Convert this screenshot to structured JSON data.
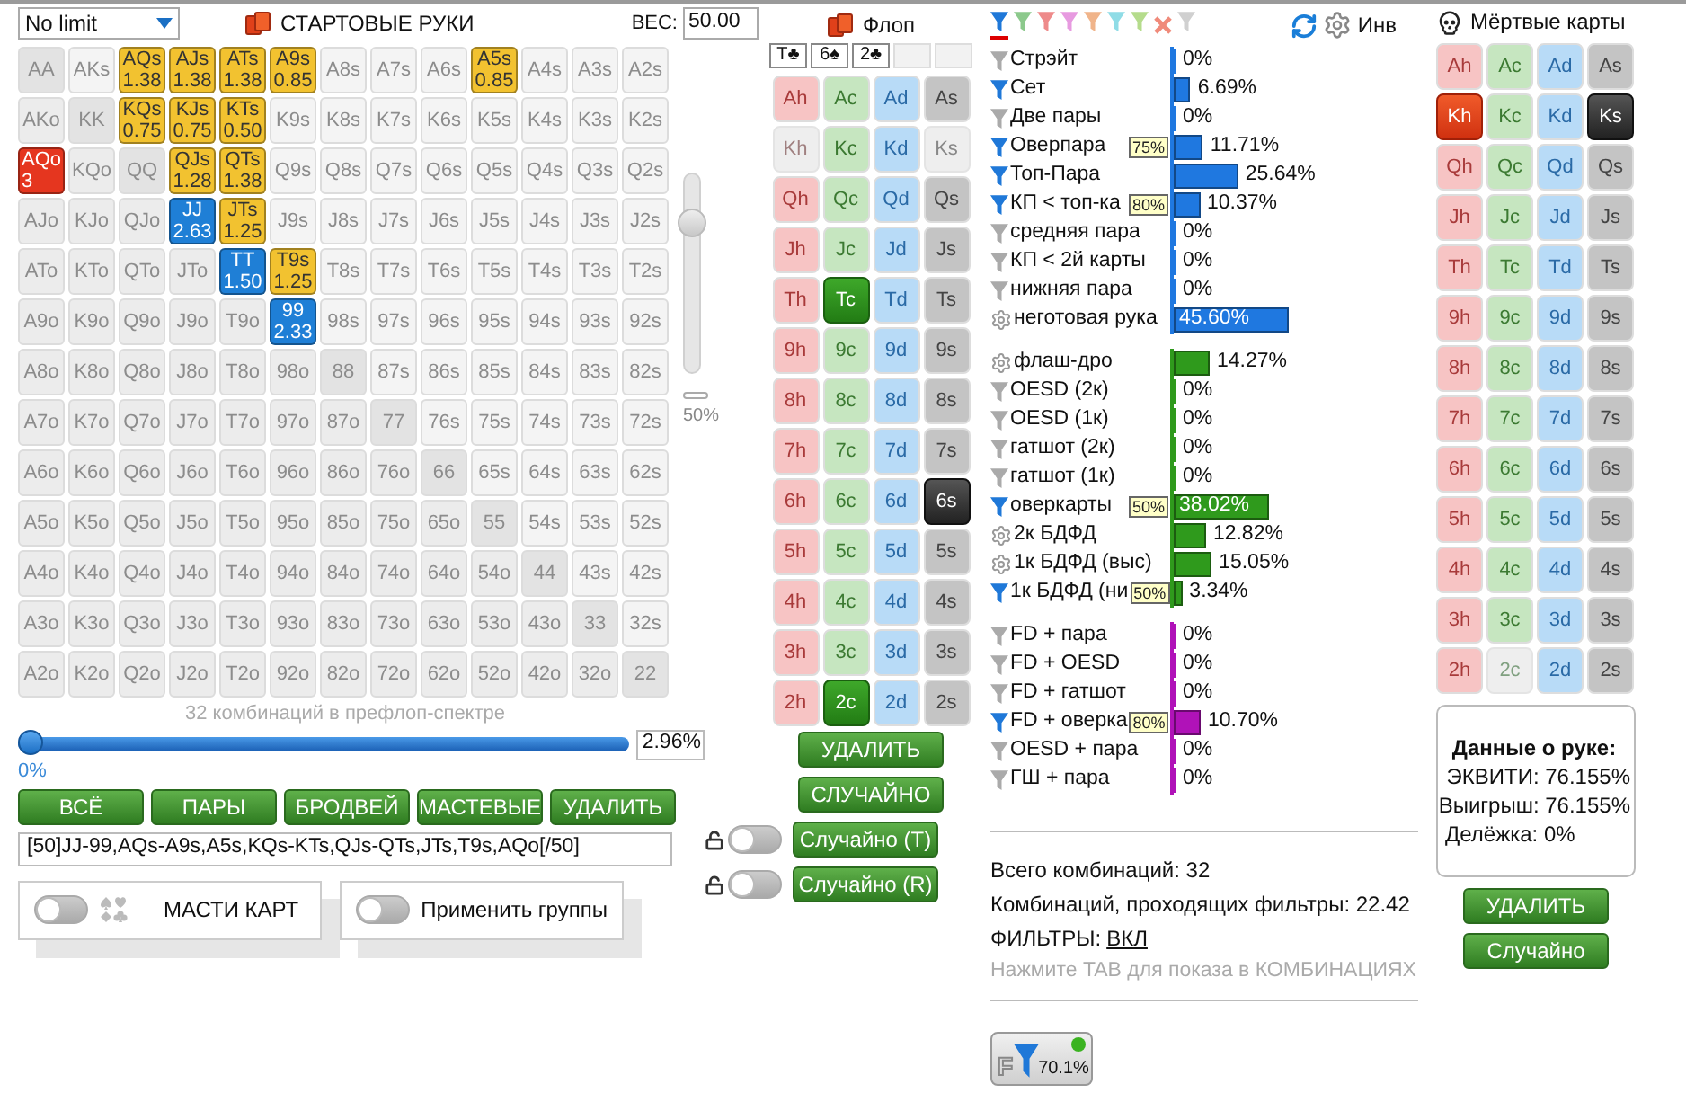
{
  "range_panel": {
    "game_select": {
      "value": "No limit"
    },
    "title": "СТАРТОВЫЕ РУКИ",
    "weight_label": "ВЕС:",
    "weight_field": {
      "value": "50.00"
    },
    "hand_grid": [
      [
        {
          "hand": "AA",
          "kind": "pair",
          "selected": false
        },
        {
          "hand": "AKs",
          "kind": "suited",
          "selected": false
        },
        {
          "hand": "AQs",
          "kind": "suited",
          "selected": true,
          "weight": "1.38",
          "color": "#f2c230"
        },
        {
          "hand": "AJs",
          "kind": "suited",
          "selected": true,
          "weight": "1.38",
          "color": "#f2c230"
        },
        {
          "hand": "ATs",
          "kind": "suited",
          "selected": true,
          "weight": "1.38",
          "color": "#f2c230"
        },
        {
          "hand": "A9s",
          "kind": "suited",
          "selected": true,
          "weight": "0.85",
          "color": "#f2c230"
        },
        {
          "hand": "A8s",
          "kind": "suited",
          "selected": false
        },
        {
          "hand": "A7s",
          "kind": "suited",
          "selected": false
        },
        {
          "hand": "A6s",
          "kind": "suited",
          "selected": false
        },
        {
          "hand": "A5s",
          "kind": "suited",
          "selected": true,
          "weight": "0.85",
          "color": "#f2c230"
        },
        {
          "hand": "A4s",
          "kind": "suited",
          "selected": false
        },
        {
          "hand": "A3s",
          "kind": "suited",
          "selected": false
        },
        {
          "hand": "A2s",
          "kind": "suited",
          "selected": false
        }
      ],
      [
        {
          "hand": "AKo",
          "kind": "offsuit",
          "selected": false
        },
        {
          "hand": "KK",
          "kind": "pair",
          "selected": false
        },
        {
          "hand": "KQs",
          "kind": "suited",
          "selected": true,
          "weight": "0.75",
          "color": "#f2c230"
        },
        {
          "hand": "KJs",
          "kind": "suited",
          "selected": true,
          "weight": "0.75",
          "color": "#f2c230"
        },
        {
          "hand": "KTs",
          "kind": "suited",
          "selected": true,
          "weight": "0.50",
          "color": "#f2c230"
        },
        {
          "hand": "K9s",
          "kind": "suited",
          "selected": false
        },
        {
          "hand": "K8s",
          "kind": "suited",
          "selected": false
        },
        {
          "hand": "K7s",
          "kind": "suited",
          "selected": false
        },
        {
          "hand": "K6s",
          "kind": "suited",
          "selected": false
        },
        {
          "hand": "K5s",
          "kind": "suited",
          "selected": false
        },
        {
          "hand": "K4s",
          "kind": "suited",
          "selected": false
        },
        {
          "hand": "K3s",
          "kind": "suited",
          "selected": false
        },
        {
          "hand": "K2s",
          "kind": "suited",
          "selected": false
        }
      ],
      [
        {
          "hand": "AQo",
          "kind": "offsuit",
          "selected": true,
          "weight": "3",
          "color": "#e5361f"
        },
        {
          "hand": "KQo",
          "kind": "offsuit",
          "selected": false
        },
        {
          "hand": "QQ",
          "kind": "pair",
          "selected": false
        },
        {
          "hand": "QJs",
          "kind": "suited",
          "selected": true,
          "weight": "1.28",
          "color": "#f2c230"
        },
        {
          "hand": "QTs",
          "kind": "suited",
          "selected": true,
          "weight": "1.38",
          "color": "#f2c230"
        },
        {
          "hand": "Q9s",
          "kind": "suited",
          "selected": false
        },
        {
          "hand": "Q8s",
          "kind": "suited",
          "selected": false
        },
        {
          "hand": "Q7s",
          "kind": "suited",
          "selected": false
        },
        {
          "hand": "Q6s",
          "kind": "suited",
          "selected": false
        },
        {
          "hand": "Q5s",
          "kind": "suited",
          "selected": false
        },
        {
          "hand": "Q4s",
          "kind": "suited",
          "selected": false
        },
        {
          "hand": "Q3s",
          "kind": "suited",
          "selected": false
        },
        {
          "hand": "Q2s",
          "kind": "suited",
          "selected": false
        }
      ],
      [
        {
          "hand": "AJo",
          "kind": "offsuit",
          "selected": false
        },
        {
          "hand": "KJo",
          "kind": "offsuit",
          "selected": false
        },
        {
          "hand": "QJo",
          "kind": "offsuit",
          "selected": false
        },
        {
          "hand": "JJ",
          "kind": "pair",
          "selected": true,
          "weight": "2.63",
          "color": "#1f7fd6"
        },
        {
          "hand": "JTs",
          "kind": "suited",
          "selected": true,
          "weight": "1.25",
          "color": "#f2c230"
        },
        {
          "hand": "J9s",
          "kind": "suited",
          "selected": false
        },
        {
          "hand": "J8s",
          "kind": "suited",
          "selected": false
        },
        {
          "hand": "J7s",
          "kind": "suited",
          "selected": false
        },
        {
          "hand": "J6s",
          "kind": "suited",
          "selected": false
        },
        {
          "hand": "J5s",
          "kind": "suited",
          "selected": false
        },
        {
          "hand": "J4s",
          "kind": "suited",
          "selected": false
        },
        {
          "hand": "J3s",
          "kind": "suited",
          "selected": false
        },
        {
          "hand": "J2s",
          "kind": "suited",
          "selected": false
        }
      ],
      [
        {
          "hand": "ATo",
          "kind": "offsuit",
          "selected": false
        },
        {
          "hand": "KTo",
          "kind": "offsuit",
          "selected": false
        },
        {
          "hand": "QTo",
          "kind": "offsuit",
          "selected": false
        },
        {
          "hand": "JTo",
          "kind": "offsuit",
          "selected": false
        },
        {
          "hand": "TT",
          "kind": "pair",
          "selected": true,
          "weight": "1.50",
          "color": "#1f7fd6"
        },
        {
          "hand": "T9s",
          "kind": "suited",
          "selected": true,
          "weight": "1.25",
          "color": "#f2c230"
        },
        {
          "hand": "T8s",
          "kind": "suited",
          "selected": false
        },
        {
          "hand": "T7s",
          "kind": "suited",
          "selected": false
        },
        {
          "hand": "T6s",
          "kind": "suited",
          "selected": false
        },
        {
          "hand": "T5s",
          "kind": "suited",
          "selected": false
        },
        {
          "hand": "T4s",
          "kind": "suited",
          "selected": false
        },
        {
          "hand": "T3s",
          "kind": "suited",
          "selected": false
        },
        {
          "hand": "T2s",
          "kind": "suited",
          "selected": false
        }
      ],
      [
        {
          "hand": "A9o",
          "kind": "offsuit",
          "selected": false
        },
        {
          "hand": "K9o",
          "kind": "offsuit",
          "selected": false
        },
        {
          "hand": "Q9o",
          "kind": "offsuit",
          "selected": false
        },
        {
          "hand": "J9o",
          "kind": "offsuit",
          "selected": false
        },
        {
          "hand": "T9o",
          "kind": "offsuit",
          "selected": false
        },
        {
          "hand": "99",
          "kind": "pair",
          "selected": true,
          "weight": "2.33",
          "color": "#1f7fd6"
        },
        {
          "hand": "98s",
          "kind": "suited",
          "selected": false
        },
        {
          "hand": "97s",
          "kind": "suited",
          "selected": false
        },
        {
          "hand": "96s",
          "kind": "suited",
          "selected": false
        },
        {
          "hand": "95s",
          "kind": "suited",
          "selected": false
        },
        {
          "hand": "94s",
          "kind": "suited",
          "selected": false
        },
        {
          "hand": "93s",
          "kind": "suited",
          "selected": false
        },
        {
          "hand": "92s",
          "kind": "suited",
          "selected": false
        }
      ],
      [
        {
          "hand": "A8o",
          "kind": "offsuit",
          "selected": false
        },
        {
          "hand": "K8o",
          "kind": "offsuit",
          "selected": false
        },
        {
          "hand": "Q8o",
          "kind": "offsuit",
          "selected": false
        },
        {
          "hand": "J8o",
          "kind": "offsuit",
          "selected": false
        },
        {
          "hand": "T8o",
          "kind": "offsuit",
          "selected": false
        },
        {
          "hand": "98o",
          "kind": "offsuit",
          "selected": false
        },
        {
          "hand": "88",
          "kind": "pair",
          "selected": false
        },
        {
          "hand": "87s",
          "kind": "suited",
          "selected": false
        },
        {
          "hand": "86s",
          "kind": "suited",
          "selected": false
        },
        {
          "hand": "85s",
          "kind": "suited",
          "selected": false
        },
        {
          "hand": "84s",
          "kind": "suited",
          "selected": false
        },
        {
          "hand": "83s",
          "kind": "suited",
          "selected": false
        },
        {
          "hand": "82s",
          "kind": "suited",
          "selected": false
        }
      ],
      [
        {
          "hand": "A7o",
          "kind": "offsuit",
          "selected": false
        },
        {
          "hand": "K7o",
          "kind": "offsuit",
          "selected": false
        },
        {
          "hand": "Q7o",
          "kind": "offsuit",
          "selected": false
        },
        {
          "hand": "J7o",
          "kind": "offsuit",
          "selected": false
        },
        {
          "hand": "T7o",
          "kind": "offsuit",
          "selected": false
        },
        {
          "hand": "97o",
          "kind": "offsuit",
          "selected": false
        },
        {
          "hand": "87o",
          "kind": "offsuit",
          "selected": false
        },
        {
          "hand": "77",
          "kind": "pair",
          "selected": false
        },
        {
          "hand": "76s",
          "kind": "suited",
          "selected": false
        },
        {
          "hand": "75s",
          "kind": "suited",
          "selected": false
        },
        {
          "hand": "74s",
          "kind": "suited",
          "selected": false
        },
        {
          "hand": "73s",
          "kind": "suited",
          "selected": false
        },
        {
          "hand": "72s",
          "kind": "suited",
          "selected": false
        }
      ],
      [
        {
          "hand": "A6o",
          "kind": "offsuit",
          "selected": false
        },
        {
          "hand": "K6o",
          "kind": "offsuit",
          "selected": false
        },
        {
          "hand": "Q6o",
          "kind": "offsuit",
          "selected": false
        },
        {
          "hand": "J6o",
          "kind": "offsuit",
          "selected": false
        },
        {
          "hand": "T6o",
          "kind": "offsuit",
          "selected": false
        },
        {
          "hand": "96o",
          "kind": "offsuit",
          "selected": false
        },
        {
          "hand": "86o",
          "kind": "offsuit",
          "selected": false
        },
        {
          "hand": "76o",
          "kind": "offsuit",
          "selected": false
        },
        {
          "hand": "66",
          "kind": "pair",
          "selected": false
        },
        {
          "hand": "65s",
          "kind": "suited",
          "selected": false
        },
        {
          "hand": "64s",
          "kind": "suited",
          "selected": false
        },
        {
          "hand": "63s",
          "kind": "suited",
          "selected": false
        },
        {
          "hand": "62s",
          "kind": "suited",
          "selected": false
        }
      ],
      [
        {
          "hand": "A5o",
          "kind": "offsuit",
          "selected": false
        },
        {
          "hand": "K5o",
          "kind": "offsuit",
          "selected": false
        },
        {
          "hand": "Q5o",
          "kind": "offsuit",
          "selected": false
        },
        {
          "hand": "J5o",
          "kind": "offsuit",
          "selected": false
        },
        {
          "hand": "T5o",
          "kind": "offsuit",
          "selected": false
        },
        {
          "hand": "95o",
          "kind": "offsuit",
          "selected": false
        },
        {
          "hand": "85o",
          "kind": "offsuit",
          "selected": false
        },
        {
          "hand": "75o",
          "kind": "offsuit",
          "selected": false
        },
        {
          "hand": "65o",
          "kind": "offsuit",
          "selected": false
        },
        {
          "hand": "55",
          "kind": "pair",
          "selected": false
        },
        {
          "hand": "54s",
          "kind": "suited",
          "selected": false
        },
        {
          "hand": "53s",
          "kind": "suited",
          "selected": false
        },
        {
          "hand": "52s",
          "kind": "suited",
          "selected": false
        }
      ],
      [
        {
          "hand": "A4o",
          "kind": "offsuit",
          "selected": false
        },
        {
          "hand": "K4o",
          "kind": "offsuit",
          "selected": false
        },
        {
          "hand": "Q4o",
          "kind": "offsuit",
          "selected": false
        },
        {
          "hand": "J4o",
          "kind": "offsuit",
          "selected": false
        },
        {
          "hand": "T4o",
          "kind": "offsuit",
          "selected": false
        },
        {
          "hand": "94o",
          "kind": "offsuit",
          "selected": false
        },
        {
          "hand": "84o",
          "kind": "offsuit",
          "selected": false
        },
        {
          "hand": "74o",
          "kind": "offsuit",
          "selected": false
        },
        {
          "hand": "64o",
          "kind": "offsuit",
          "selected": false
        },
        {
          "hand": "54o",
          "kind": "offsuit",
          "selected": false
        },
        {
          "hand": "44",
          "kind": "pair",
          "selected": false
        },
        {
          "hand": "43s",
          "kind": "suited",
          "selected": false
        },
        {
          "hand": "42s",
          "kind": "suited",
          "selected": false
        }
      ],
      [
        {
          "hand": "A3o",
          "kind": "offsuit",
          "selected": false
        },
        {
          "hand": "K3o",
          "kind": "offsuit",
          "selected": false
        },
        {
          "hand": "Q3o",
          "kind": "offsuit",
          "selected": false
        },
        {
          "hand": "J3o",
          "kind": "offsuit",
          "selected": false
        },
        {
          "hand": "T3o",
          "kind": "offsuit",
          "selected": false
        },
        {
          "hand": "93o",
          "kind": "offsuit",
          "selected": false
        },
        {
          "hand": "83o",
          "kind": "offsuit",
          "selected": false
        },
        {
          "hand": "73o",
          "kind": "offsuit",
          "selected": false
        },
        {
          "hand": "63o",
          "kind": "offsuit",
          "selected": false
        },
        {
          "hand": "53o",
          "kind": "offsuit",
          "selected": false
        },
        {
          "hand": "43o",
          "kind": "offsuit",
          "selected": false
        },
        {
          "hand": "33",
          "kind": "pair",
          "selected": false
        },
        {
          "hand": "32s",
          "kind": "suited",
          "selected": false
        }
      ],
      [
        {
          "hand": "A2o",
          "kind": "offsuit",
          "selected": false
        },
        {
          "hand": "K2o",
          "kind": "offsuit",
          "selected": false
        },
        {
          "hand": "Q2o",
          "kind": "offsuit",
          "selected": false
        },
        {
          "hand": "J2o",
          "kind": "offsuit",
          "selected": false
        },
        {
          "hand": "T2o",
          "kind": "offsuit",
          "selected": false
        },
        {
          "hand": "92o",
          "kind": "offsuit",
          "selected": false
        },
        {
          "hand": "82o",
          "kind": "offsuit",
          "selected": false
        },
        {
          "hand": "72o",
          "kind": "offsuit",
          "selected": false
        },
        {
          "hand": "62o",
          "kind": "offsuit",
          "selected": false
        },
        {
          "hand": "52o",
          "kind": "offsuit",
          "selected": false
        },
        {
          "hand": "42o",
          "kind": "offsuit",
          "selected": false
        },
        {
          "hand": "32o",
          "kind": "offsuit",
          "selected": false
        },
        {
          "hand": "22",
          "kind": "pair",
          "selected": false
        }
      ]
    ],
    "weight_slider": {
      "level": 0.8,
      "reading": "50%"
    },
    "combos_caption": "32 комбинаций в префлоп-спектре",
    "range_slider": {
      "level": 0,
      "min_label": "0%",
      "value": "2.96%"
    },
    "buttons": [
      "ВСЁ",
      "ПАРЫ",
      "БРОДВЕЙ",
      "МАСТЕВЫЕ",
      "УДАЛИТЬ"
    ],
    "range_field": {
      "value": "[50]JJ-99,AQs-A9s,A5s,KQs-KTs,QJs-QTs,JTs,T9s,AQo[/50]"
    },
    "toggles": [
      {
        "kind": "suits",
        "label": "МАСТИ КАРТ",
        "on": false
      },
      {
        "kind": "plain",
        "label": "Применить группы",
        "on": false
      }
    ]
  },
  "flop_panel": {
    "title": "Флоп",
    "board_slots": [
      {
        "filled": true,
        "card": "T♣"
      },
      {
        "filled": true,
        "card": "6♠"
      },
      {
        "filled": true,
        "card": "2♣"
      },
      {
        "filled": false
      },
      {
        "filled": false
      }
    ],
    "deck": [
      [
        {
          "card": "Ah",
          "kind": "heart",
          "selected": false,
          "disabled": false
        },
        {
          "card": "Ac",
          "kind": "club",
          "selected": false,
          "disabled": false
        },
        {
          "card": "Ad",
          "kind": "diamond",
          "selected": false,
          "disabled": false
        },
        {
          "card": "As",
          "kind": "spade",
          "selected": false,
          "disabled": false
        }
      ],
      [
        {
          "card": "Kh",
          "kind": "heart",
          "selected": false,
          "disabled": true
        },
        {
          "card": "Kc",
          "kind": "club",
          "selected": false,
          "disabled": false
        },
        {
          "card": "Kd",
          "kind": "diamond",
          "selected": false,
          "disabled": false
        },
        {
          "card": "Ks",
          "kind": "spade",
          "selected": false,
          "disabled": true
        }
      ],
      [
        {
          "card": "Qh",
          "kind": "heart",
          "selected": false,
          "disabled": false
        },
        {
          "card": "Qc",
          "kind": "club",
          "selected": false,
          "disabled": false
        },
        {
          "card": "Qd",
          "kind": "diamond",
          "selected": false,
          "disabled": false
        },
        {
          "card": "Qs",
          "kind": "spade",
          "selected": false,
          "disabled": false
        }
      ],
      [
        {
          "card": "Jh",
          "kind": "heart",
          "selected": false,
          "disabled": false
        },
        {
          "card": "Jc",
          "kind": "club",
          "selected": false,
          "disabled": false
        },
        {
          "card": "Jd",
          "kind": "diamond",
          "selected": false,
          "disabled": false
        },
        {
          "card": "Js",
          "kind": "spade",
          "selected": false,
          "disabled": false
        }
      ],
      [
        {
          "card": "Th",
          "kind": "heart",
          "selected": false,
          "disabled": false
        },
        {
          "card": "Tc",
          "kind": "club",
          "selected": true,
          "disabled": false
        },
        {
          "card": "Td",
          "kind": "diamond",
          "selected": false,
          "disabled": false
        },
        {
          "card": "Ts",
          "kind": "spade",
          "selected": false,
          "disabled": false
        }
      ],
      [
        {
          "card": "9h",
          "kind": "heart",
          "selected": false,
          "disabled": false
        },
        {
          "card": "9c",
          "kind": "club",
          "selected": false,
          "disabled": false
        },
        {
          "card": "9d",
          "kind": "diamond",
          "selected": false,
          "disabled": false
        },
        {
          "card": "9s",
          "kind": "spade",
          "selected": false,
          "disabled": false
        }
      ],
      [
        {
          "card": "8h",
          "kind": "heart",
          "selected": false,
          "disabled": false
        },
        {
          "card": "8c",
          "kind": "club",
          "selected": false,
          "disabled": false
        },
        {
          "card": "8d",
          "kind": "diamond",
          "selected": false,
          "disabled": false
        },
        {
          "card": "8s",
          "kind": "spade",
          "selected": false,
          "disabled": false
        }
      ],
      [
        {
          "card": "7h",
          "kind": "heart",
          "selected": false,
          "disabled": false
        },
        {
          "card": "7c",
          "kind": "club",
          "selected": false,
          "disabled": false
        },
        {
          "card": "7d",
          "kind": "diamond",
          "selected": false,
          "disabled": false
        },
        {
          "card": "7s",
          "kind": "spade",
          "selected": false,
          "disabled": false
        }
      ],
      [
        {
          "card": "6h",
          "kind": "heart",
          "selected": false,
          "disabled": false
        },
        {
          "card": "6c",
          "kind": "club",
          "selected": false,
          "disabled": false
        },
        {
          "card": "6d",
          "kind": "diamond",
          "selected": false,
          "disabled": false
        },
        {
          "card": "6s",
          "kind": "spade",
          "selected": true,
          "disabled": false
        }
      ],
      [
        {
          "card": "5h",
          "kind": "heart",
          "selected": false,
          "disabled": false
        },
        {
          "card": "5c",
          "kind": "club",
          "selected": false,
          "disabled": false
        },
        {
          "card": "5d",
          "kind": "diamond",
          "selected": false,
          "disabled": false
        },
        {
          "card": "5s",
          "kind": "spade",
          "selected": false,
          "disabled": false
        }
      ],
      [
        {
          "card": "4h",
          "kind": "heart",
          "selected": false,
          "disabled": false
        },
        {
          "card": "4c",
          "kind": "club",
          "selected": false,
          "disabled": false
        },
        {
          "card": "4d",
          "kind": "diamond",
          "selected": false,
          "disabled": false
        },
        {
          "card": "4s",
          "kind": "spade",
          "selected": false,
          "disabled": false
        }
      ],
      [
        {
          "card": "3h",
          "kind": "heart",
          "selected": false,
          "disabled": false
        },
        {
          "card": "3c",
          "kind": "club",
          "selected": false,
          "disabled": false
        },
        {
          "card": "3d",
          "kind": "diamond",
          "selected": false,
          "disabled": false
        },
        {
          "card": "3s",
          "kind": "spade",
          "selected": false,
          "disabled": false
        }
      ],
      [
        {
          "card": "2h",
          "kind": "heart",
          "selected": false,
          "disabled": false
        },
        {
          "card": "2c",
          "kind": "club",
          "selected": true,
          "disabled": false
        },
        {
          "card": "2d",
          "kind": "diamond",
          "selected": false,
          "disabled": false
        },
        {
          "card": "2s",
          "kind": "spade",
          "selected": false,
          "disabled": false
        }
      ]
    ],
    "buttons": [
      "УДАЛИТЬ",
      "СЛУЧАЙНО"
    ],
    "random_toggles": [
      {
        "label": "Случайно (T)",
        "on": false
      },
      {
        "label": "Случайно (R)",
        "on": false
      }
    ]
  },
  "stats_panel": {
    "filter_tabs": [
      {
        "kind": "filter",
        "color": "#1f78d8",
        "selected": true
      },
      {
        "kind": "filter",
        "color": "#8cc98c",
        "selected": false
      },
      {
        "kind": "filter",
        "color": "#ee8a8a",
        "selected": false
      },
      {
        "kind": "filter",
        "color": "#e79ae0",
        "selected": false
      },
      {
        "kind": "filter",
        "color": "#f0b48a",
        "selected": false
      },
      {
        "kind": "filter",
        "color": "#8fdce6",
        "selected": false
      },
      {
        "kind": "filter",
        "color": "#b5dc8c",
        "selected": false
      },
      {
        "kind": "clear",
        "color": "#f08a7a",
        "selected": false
      },
      {
        "kind": "filter",
        "color": "#d0d0d0",
        "selected": false
      }
    ],
    "invert_label": "Инв",
    "groups": [
      {
        "color": "#1f78e0",
        "rows": [
          {
            "kind": "filter",
            "active": false,
            "label": "Стрэйт",
            "value": "0%",
            "level": 0
          },
          {
            "kind": "filter",
            "active": true,
            "label": "Сет",
            "value": "6.69%",
            "level": 0.0669
          },
          {
            "kind": "filter",
            "active": false,
            "label": "Две пары",
            "value": "0%",
            "level": 0
          },
          {
            "kind": "filter",
            "active": true,
            "label": "Оверпара",
            "badge": "75%",
            "value": "11.71%",
            "level": 0.1171
          },
          {
            "kind": "filter",
            "active": true,
            "label": "Топ-Пара",
            "value": "25.64%",
            "level": 0.2564
          },
          {
            "kind": "filter",
            "active": true,
            "label": "КП < топ-ка",
            "badge": "80%",
            "value": "10.37%",
            "level": 0.1037
          },
          {
            "kind": "filter",
            "active": false,
            "label": "средняя пара",
            "value": "0%",
            "level": 0
          },
          {
            "kind": "filter",
            "active": false,
            "label": "КП < 2й карты",
            "value": "0%",
            "level": 0
          },
          {
            "kind": "filter",
            "active": false,
            "label": "нижняя пара",
            "value": "0%",
            "level": 0
          },
          {
            "kind": "gear",
            "label": "неготовая рука",
            "value": "45.60%",
            "level": 0.456
          }
        ]
      },
      {
        "color": "#2f9a1c",
        "rows": [
          {
            "kind": "gear",
            "label": "флаш-дро",
            "value": "14.27%",
            "level": 0.1427
          },
          {
            "kind": "filter",
            "active": false,
            "label": "OESD (2к)",
            "value": "0%",
            "level": 0
          },
          {
            "kind": "filter",
            "active": false,
            "label": "OESD (1к)",
            "value": "0%",
            "level": 0
          },
          {
            "kind": "filter",
            "active": false,
            "label": "гатшот (2к)",
            "value": "0%",
            "level": 0
          },
          {
            "kind": "filter",
            "active": false,
            "label": "гатшот (1к)",
            "value": "0%",
            "level": 0
          },
          {
            "kind": "filter",
            "active": true,
            "label": "оверкарты",
            "badge": "50%",
            "value": "38.02%",
            "level": 0.3802
          },
          {
            "kind": "gear",
            "label": "2к БДФД",
            "value": "12.82%",
            "level": 0.1282
          },
          {
            "kind": "gear",
            "label": "1к БДФД (выс)",
            "value": "15.05%",
            "level": 0.1505
          },
          {
            "kind": "filter",
            "active": true,
            "label": "1к БДФД (ни",
            "badge": "50%",
            "value": "3.34%",
            "level": 0.0334
          }
        ]
      },
      {
        "color": "#b012b8",
        "rows": [
          {
            "kind": "filter",
            "active": false,
            "label": "FD + пара",
            "value": "0%",
            "level": 0
          },
          {
            "kind": "filter",
            "active": false,
            "label": "FD + OESD",
            "value": "0%",
            "level": 0
          },
          {
            "kind": "filter",
            "active": false,
            "label": "FD + гатшот",
            "value": "0%",
            "level": 0
          },
          {
            "kind": "filter",
            "active": true,
            "label": "FD + оверка",
            "badge": "80%",
            "value": "10.70%",
            "level": 0.107
          },
          {
            "kind": "filter",
            "active": false,
            "label": "OESD + пара",
            "value": "0%",
            "level": 0
          },
          {
            "kind": "filter",
            "active": false,
            "label": "ГШ + пара",
            "value": "0%",
            "level": 0
          }
        ]
      }
    ],
    "total_combos": "Всего комбинаций: 32",
    "passing_combos": "Комбинаций, проходящих фильтры: 22.42",
    "filters_label": "ФИЛЬТРЫ:",
    "filters_link": "ВКЛ",
    "hint": "Нажмите TAB для показа в КОМБИНАЦИЯХ",
    "filter_button": {
      "letter": "F",
      "value": "70.1%",
      "active": true
    }
  },
  "dead_cards_panel": {
    "title": "Мёртвые карты",
    "deck": [
      [
        {
          "card": "Ah",
          "kind": "heart",
          "selected": false,
          "disabled": false
        },
        {
          "card": "Ac",
          "kind": "club",
          "selected": false,
          "disabled": false
        },
        {
          "card": "Ad",
          "kind": "diamond",
          "selected": false,
          "disabled": false
        },
        {
          "card": "As",
          "kind": "spade",
          "selected": false,
          "disabled": false
        }
      ],
      [
        {
          "card": "Kh",
          "kind": "heart",
          "selected": true,
          "disabled": false
        },
        {
          "card": "Kc",
          "kind": "club",
          "selected": false,
          "disabled": false
        },
        {
          "card": "Kd",
          "kind": "diamond",
          "selected": false,
          "disabled": false
        },
        {
          "card": "Ks",
          "kind": "spade",
          "selected": true,
          "disabled": false
        }
      ],
      [
        {
          "card": "Qh",
          "kind": "heart",
          "selected": false,
          "disabled": false
        },
        {
          "card": "Qc",
          "kind": "club",
          "selected": false,
          "disabled": false
        },
        {
          "card": "Qd",
          "kind": "diamond",
          "selected": false,
          "disabled": false
        },
        {
          "card": "Qs",
          "kind": "spade",
          "selected": false,
          "disabled": false
        }
      ],
      [
        {
          "card": "Jh",
          "kind": "heart",
          "selected": false,
          "disabled": false
        },
        {
          "card": "Jc",
          "kind": "club",
          "selected": false,
          "disabled": false
        },
        {
          "card": "Jd",
          "kind": "diamond",
          "selected": false,
          "disabled": false
        },
        {
          "card": "Js",
          "kind": "spade",
          "selected": false,
          "disabled": false
        }
      ],
      [
        {
          "card": "Th",
          "kind": "heart",
          "selected": false,
          "disabled": false
        },
        {
          "card": "Tc",
          "kind": "club",
          "selected": false,
          "disabled": false
        },
        {
          "card": "Td",
          "kind": "diamond",
          "selected": false,
          "disabled": false
        },
        {
          "card": "Ts",
          "kind": "spade",
          "selected": false,
          "disabled": false
        }
      ],
      [
        {
          "card": "9h",
          "kind": "heart",
          "selected": false,
          "disabled": false
        },
        {
          "card": "9c",
          "kind": "club",
          "selected": false,
          "disabled": false
        },
        {
          "card": "9d",
          "kind": "diamond",
          "selected": false,
          "disabled": false
        },
        {
          "card": "9s",
          "kind": "spade",
          "selected": false,
          "disabled": false
        }
      ],
      [
        {
          "card": "8h",
          "kind": "heart",
          "selected": false,
          "disabled": false
        },
        {
          "card": "8c",
          "kind": "club",
          "selected": false,
          "disabled": false
        },
        {
          "card": "8d",
          "kind": "diamond",
          "selected": false,
          "disabled": false
        },
        {
          "card": "8s",
          "kind": "spade",
          "selected": false,
          "disabled": false
        }
      ],
      [
        {
          "card": "7h",
          "kind": "heart",
          "selected": false,
          "disabled": false
        },
        {
          "card": "7c",
          "kind": "club",
          "selected": false,
          "disabled": false
        },
        {
          "card": "7d",
          "kind": "diamond",
          "selected": false,
          "disabled": false
        },
        {
          "card": "7s",
          "kind": "spade",
          "selected": false,
          "disabled": false
        }
      ],
      [
        {
          "card": "6h",
          "kind": "heart",
          "selected": false,
          "disabled": false
        },
        {
          "card": "6c",
          "kind": "club",
          "selected": false,
          "disabled": false
        },
        {
          "card": "6d",
          "kind": "diamond",
          "selected": false,
          "disabled": false
        },
        {
          "card": "6s",
          "kind": "spade",
          "selected": false,
          "disabled": false
        }
      ],
      [
        {
          "card": "5h",
          "kind": "heart",
          "selected": false,
          "disabled": false
        },
        {
          "card": "5c",
          "kind": "club",
          "selected": false,
          "disabled": false
        },
        {
          "card": "5d",
          "kind": "diamond",
          "selected": false,
          "disabled": false
        },
        {
          "card": "5s",
          "kind": "spade",
          "selected": false,
          "disabled": false
        }
      ],
      [
        {
          "card": "4h",
          "kind": "heart",
          "selected": false,
          "disabled": false
        },
        {
          "card": "4c",
          "kind": "club",
          "selected": false,
          "disabled": false
        },
        {
          "card": "4d",
          "kind": "diamond",
          "selected": false,
          "disabled": false
        },
        {
          "card": "4s",
          "kind": "spade",
          "selected": false,
          "disabled": false
        }
      ],
      [
        {
          "card": "3h",
          "kind": "heart",
          "selected": false,
          "disabled": false
        },
        {
          "card": "3c",
          "kind": "club",
          "selected": false,
          "disabled": false
        },
        {
          "card": "3d",
          "kind": "diamond",
          "selected": false,
          "disabled": false
        },
        {
          "card": "3s",
          "kind": "spade",
          "selected": false,
          "disabled": false
        }
      ],
      [
        {
          "card": "2h",
          "kind": "heart",
          "selected": false,
          "disabled": false
        },
        {
          "card": "2c",
          "kind": "club",
          "selected": false,
          "disabled": true
        },
        {
          "card": "2d",
          "kind": "diamond",
          "selected": false,
          "disabled": false
        },
        {
          "card": "2s",
          "kind": "spade",
          "selected": false,
          "disabled": false
        }
      ]
    ],
    "hand_data": {
      "title": "Данные о руке:",
      "lines": [
        "ЭКВИТИ: 76.155%",
        "Выигрыш: 76.155%",
        "Делёжка: 0%"
      ]
    },
    "buttons": [
      "УДАЛИТЬ",
      "Случайно"
    ]
  }
}
